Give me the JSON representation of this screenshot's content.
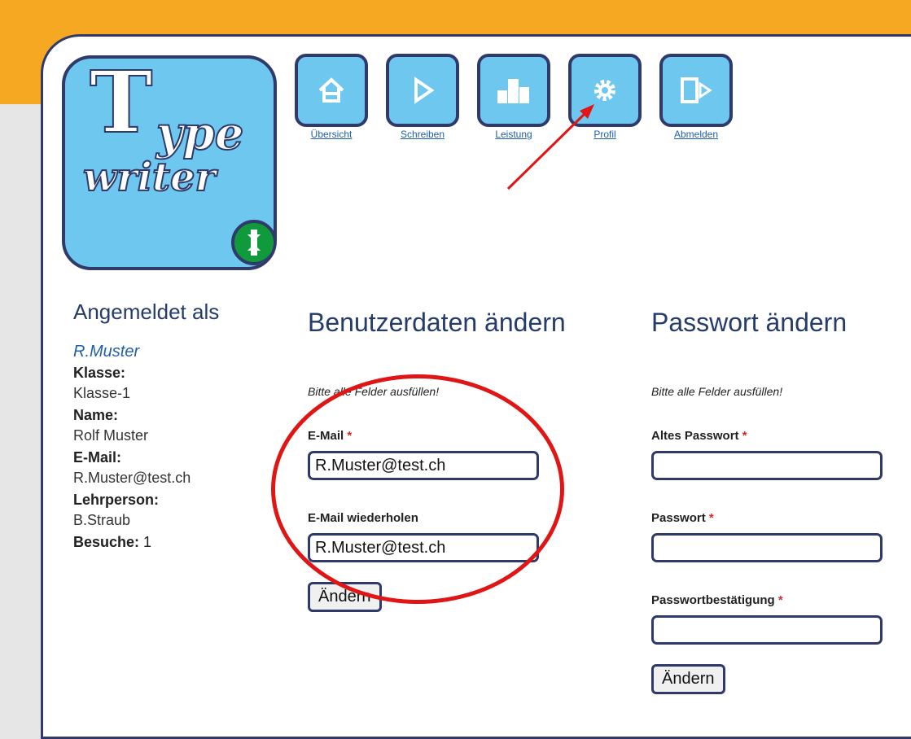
{
  "logo": {
    "line1": "T",
    "line2": "ype",
    "line3": "writer"
  },
  "nav": [
    {
      "label": "Übersicht",
      "icon": "home-icon"
    },
    {
      "label": "Schreiben",
      "icon": "play-icon"
    },
    {
      "label": "Leistung",
      "icon": "bars-icon"
    },
    {
      "label": "Profil",
      "icon": "gear-icon"
    },
    {
      "label": "Abmelden",
      "icon": "logout-icon"
    }
  ],
  "sidebar": {
    "title": "Angemeldet als",
    "username": "R.Muster",
    "class_label": "Klasse:",
    "class_value": "Klasse-1",
    "name_label": "Name:",
    "name_value": "Rolf Muster",
    "email_label": "E-Mail:",
    "email_value": "R.Muster@test.ch",
    "teacher_label": "Lehrperson:",
    "teacher_value": "B.Straub",
    "visits_label": "Besuche:",
    "visits_value": "1"
  },
  "userdata": {
    "title": "Benutzerdaten ändern",
    "hint": "Bitte alle Felder ausfüllen!",
    "email_label": "E-Mail",
    "email_value": "R.Muster@test.ch",
    "email_repeat_label": "E-Mail wiederholen",
    "email_repeat_value": "R.Muster@test.ch",
    "submit": "Ändern"
  },
  "password": {
    "title": "Passwort ändern",
    "hint": "Bitte alle Felder ausfüllen!",
    "old_label": "Altes Passwort",
    "old_value": "",
    "new_label": "Passwort",
    "new_value": "",
    "confirm_label": "Passwortbestätigung",
    "confirm_value": "",
    "submit": "Ändern"
  },
  "required_mark": "*",
  "colors": {
    "accent_orange": "#f7a823",
    "navy": "#2f3a6b",
    "tile_blue": "#6ec7ee",
    "link_blue": "#1f5fa8",
    "annotation_red": "#e01515"
  }
}
